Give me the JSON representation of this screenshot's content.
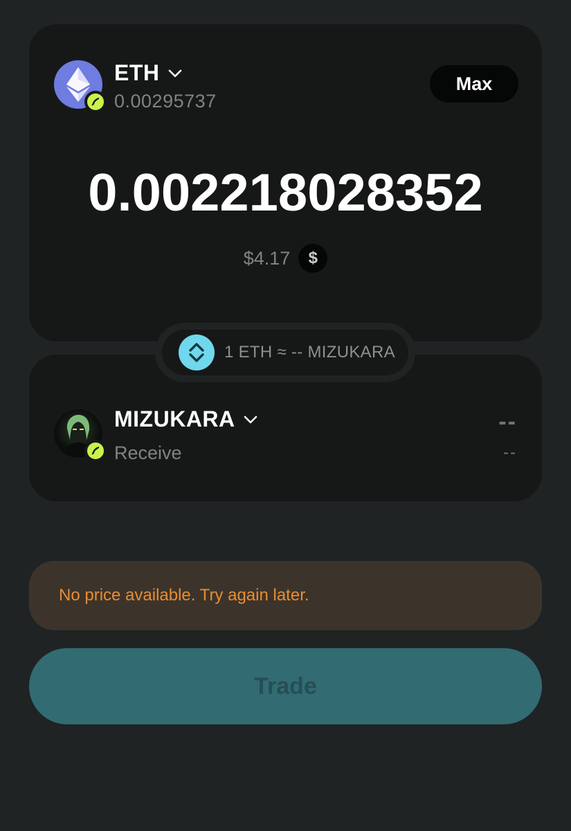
{
  "pay": {
    "token_symbol": "ETH",
    "balance": "0.00295737",
    "max_label": "Max",
    "amount": "0.002218028352",
    "usd_value": "$4.17",
    "usd_icon_glyph": "$",
    "logo_color": "#6f7ce0"
  },
  "rate": {
    "text": "1 ETH ≈ -- MIZUKARA",
    "icon_color": "#6fd8ec"
  },
  "receive": {
    "token_symbol": "MIZUKARA",
    "label": "Receive",
    "amount": "--",
    "usd_value": "--"
  },
  "warning": {
    "text": "No price available. Try again later.",
    "color": "#e88d34"
  },
  "trade": {
    "label": "Trade",
    "color": "#336b72"
  },
  "colors": {
    "background": "#1f2323",
    "card": "#161818",
    "badge": "#c9f24b"
  }
}
